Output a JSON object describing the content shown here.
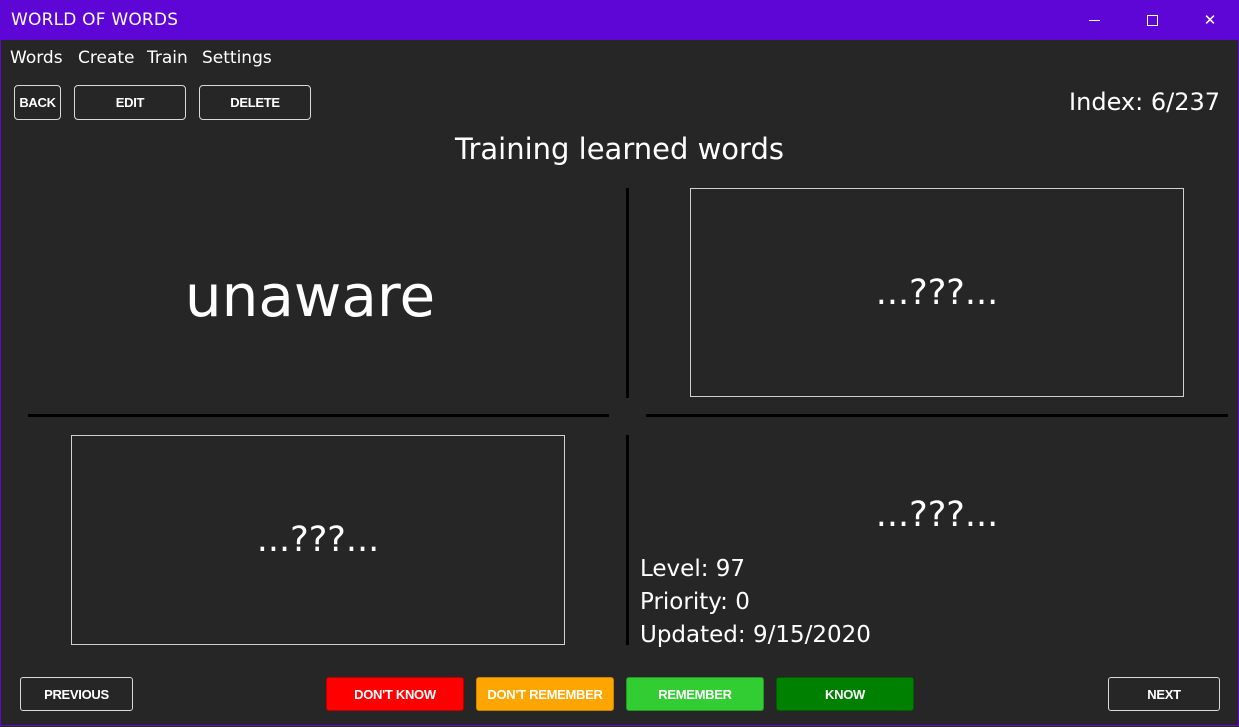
{
  "window": {
    "title": "WORLD OF WORDS",
    "accent_color": "#5e06d6",
    "controls": {
      "minimize_icon": "minimize-icon",
      "maximize_icon": "maximize-icon",
      "close_icon": "close-icon",
      "close_glyph": "✕"
    }
  },
  "menu": {
    "items": [
      {
        "label": "Words"
      },
      {
        "label": "Create"
      },
      {
        "label": "Train"
      },
      {
        "label": "Settings"
      }
    ]
  },
  "toolbar": {
    "back_label": "BACK",
    "edit_label": "EDIT",
    "delete_label": "DELETE",
    "index_text": "Index: 6/237"
  },
  "page": {
    "heading": "Training learned words"
  },
  "card": {
    "word": "unaware",
    "hidden_top_right": "...???...",
    "hidden_bottom_left": "...???...",
    "hidden_bottom_right": "...???...",
    "level_text": "Level: 97",
    "priority_text": "Priority: 0",
    "updated_text": "Updated: 9/15/2020"
  },
  "footer": {
    "previous_label": "PREVIOUS",
    "dont_know_label": "DON'T KNOW",
    "dont_remember_label": "DON'T REMEMBER",
    "remember_label": "REMEMBER",
    "know_label": "KNOW",
    "next_label": "NEXT",
    "colors": {
      "dont_know": "#ff0000",
      "dont_remember": "#ffa500",
      "remember": "#32cd32",
      "know": "#008000"
    }
  }
}
